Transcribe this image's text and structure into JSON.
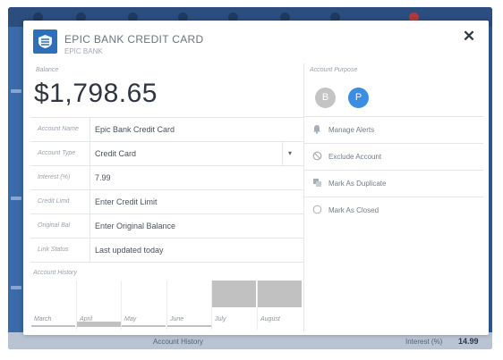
{
  "background": {
    "bottom_label": "Account History",
    "interest_label": "Interest (%)",
    "interest_value": "14.99"
  },
  "modal": {
    "bank_name": "EPIC BANK CREDIT CARD",
    "bank_sub": "EPIC BANK",
    "close_label": "✕"
  },
  "balance": {
    "label": "Balance",
    "value": "$1,798.65"
  },
  "fields": [
    {
      "label": "Account Name",
      "value": "Epic Bank Credit Card"
    },
    {
      "label": "Account Type",
      "value": "Credit Card",
      "caret": "▾"
    },
    {
      "label": "Interest (%)",
      "value": "7.99"
    },
    {
      "label": "Credit Limit",
      "value": "Enter Credit Limit"
    },
    {
      "label": "Original Bal",
      "value": "Enter Original Balance"
    },
    {
      "label": "Link Status",
      "value": "Last updated today"
    }
  ],
  "history": {
    "label": "Account History",
    "months": [
      "March",
      "April",
      "May",
      "June",
      "July",
      "August"
    ],
    "levels": [
      0.05,
      0.12,
      0.02,
      0.02,
      0.62,
      0.62
    ]
  },
  "purpose": {
    "label": "Account Purpose",
    "options": [
      {
        "letter": "B",
        "selected": false
      },
      {
        "letter": "P",
        "selected": true
      }
    ]
  },
  "actions": [
    {
      "icon": "bell-icon",
      "glyph": "🔔",
      "label": "Manage Alerts"
    },
    {
      "icon": "exclude-icon",
      "glyph": "⊘",
      "label": "Exclude Account"
    },
    {
      "icon": "duplicate-icon",
      "glyph": "⧉",
      "label": "Mark As Duplicate"
    },
    {
      "icon": "closed-circle-icon",
      "glyph": "○",
      "label": "Mark As Closed"
    }
  ],
  "colors": {
    "brand_blue": "#2e6fba",
    "selected_purpose": "#3c8de0",
    "unselected_purpose": "#c4c4c4",
    "frame_blue": "#2d5c9a"
  }
}
